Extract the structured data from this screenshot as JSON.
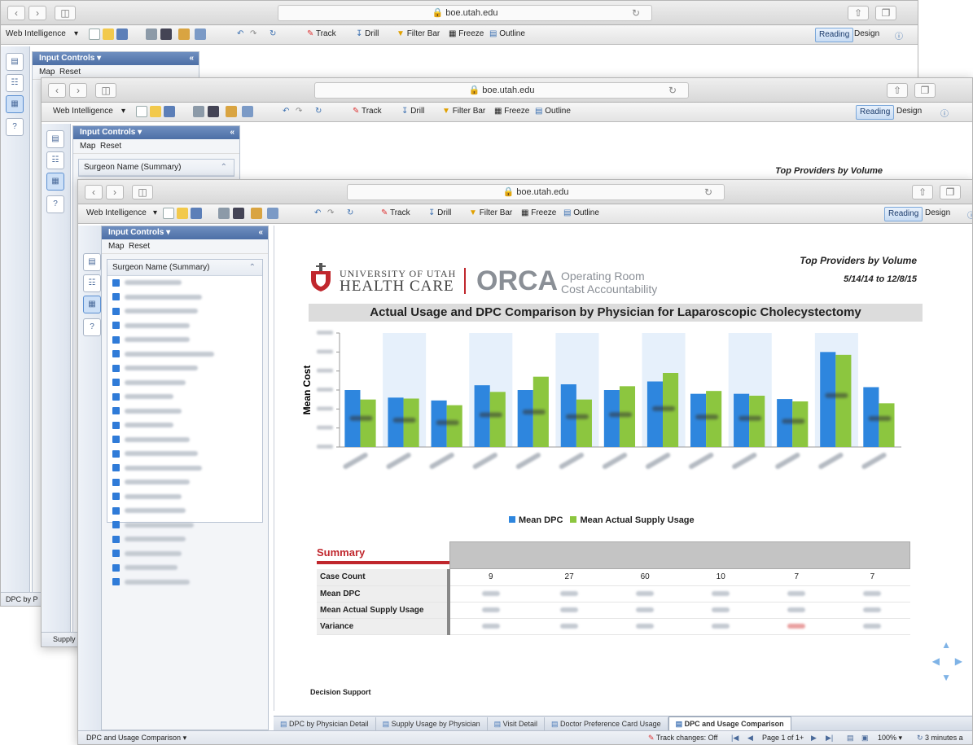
{
  "browser": {
    "url": "boe.utah.edu"
  },
  "toolbar": {
    "app_label": "Web Intelligence",
    "track": "Track",
    "drill": "Drill",
    "filter_bar": "Filter Bar",
    "freeze": "Freeze",
    "outline": "Outline",
    "reading": "Reading",
    "design": "Design"
  },
  "side_panel": {
    "title": "Input Controls",
    "map": "Map",
    "reset": "Reset",
    "surgeon_header": "Surgeon Name (Summary)"
  },
  "back_windows": {
    "w1_status": "DPC by P",
    "w2_status": "Supply U",
    "w2_report_title": "Top Providers by Volume"
  },
  "report": {
    "org_line1": "UNIVERSITY OF UTAH",
    "org_line2": "HEALTH CARE",
    "brand": "ORCA",
    "brand_sub1": "Operating Room",
    "brand_sub2": "Cost Accountability",
    "top_title": "Top Providers by Volume",
    "date_range": "5/14/14 to 12/8/15",
    "chart_title": "Actual Usage and DPC Comparison by Physician for Laparoscopic Cholecystectomy",
    "footer": "Decision Support"
  },
  "chart_data": {
    "type": "bar",
    "title": "Actual Usage and DPC Comparison by Physician for Laparoscopic Cholecystectomy",
    "ylabel": "Mean Cost",
    "xlabel": "",
    "series": [
      {
        "name": "Mean DPC",
        "color": "#2e86de",
        "values": [
          600,
          520,
          490,
          650,
          600,
          660,
          600,
          690,
          560,
          560,
          505,
          1000,
          630
        ]
      },
      {
        "name": "Mean Actual Supply Usage",
        "color": "#8cc63f",
        "values": [
          500,
          510,
          440,
          580,
          740,
          500,
          640,
          780,
          590,
          540,
          480,
          970,
          460
        ]
      }
    ],
    "ylim": [
      0,
      1200
    ],
    "legend_position": "bottom"
  },
  "summary": {
    "title": "Summary",
    "row_labels": [
      "Case Count",
      "Mean DPC",
      "Mean Actual Supply Usage",
      "Variance"
    ],
    "case_counts": [
      "9",
      "27",
      "60",
      "10",
      "7",
      "7"
    ]
  },
  "tabs": [
    {
      "label": "DPC by Physician Detail"
    },
    {
      "label": "Supply Usage by Physician"
    },
    {
      "label": "Visit Detail"
    },
    {
      "label": "Doctor Preference Card Usage"
    },
    {
      "label": "DPC and Usage Comparison"
    }
  ],
  "statusbar": {
    "left": "DPC and Usage Comparison",
    "track_changes": "Track changes: Off",
    "page": "Page 1 of 1+",
    "zoom": "100%",
    "refresh": "3 minutes a"
  },
  "colors": {
    "accent_red": "#c0272d",
    "bar_blue": "#2e86de",
    "bar_green": "#8cc63f",
    "panel_header": "#4d6fa6"
  }
}
